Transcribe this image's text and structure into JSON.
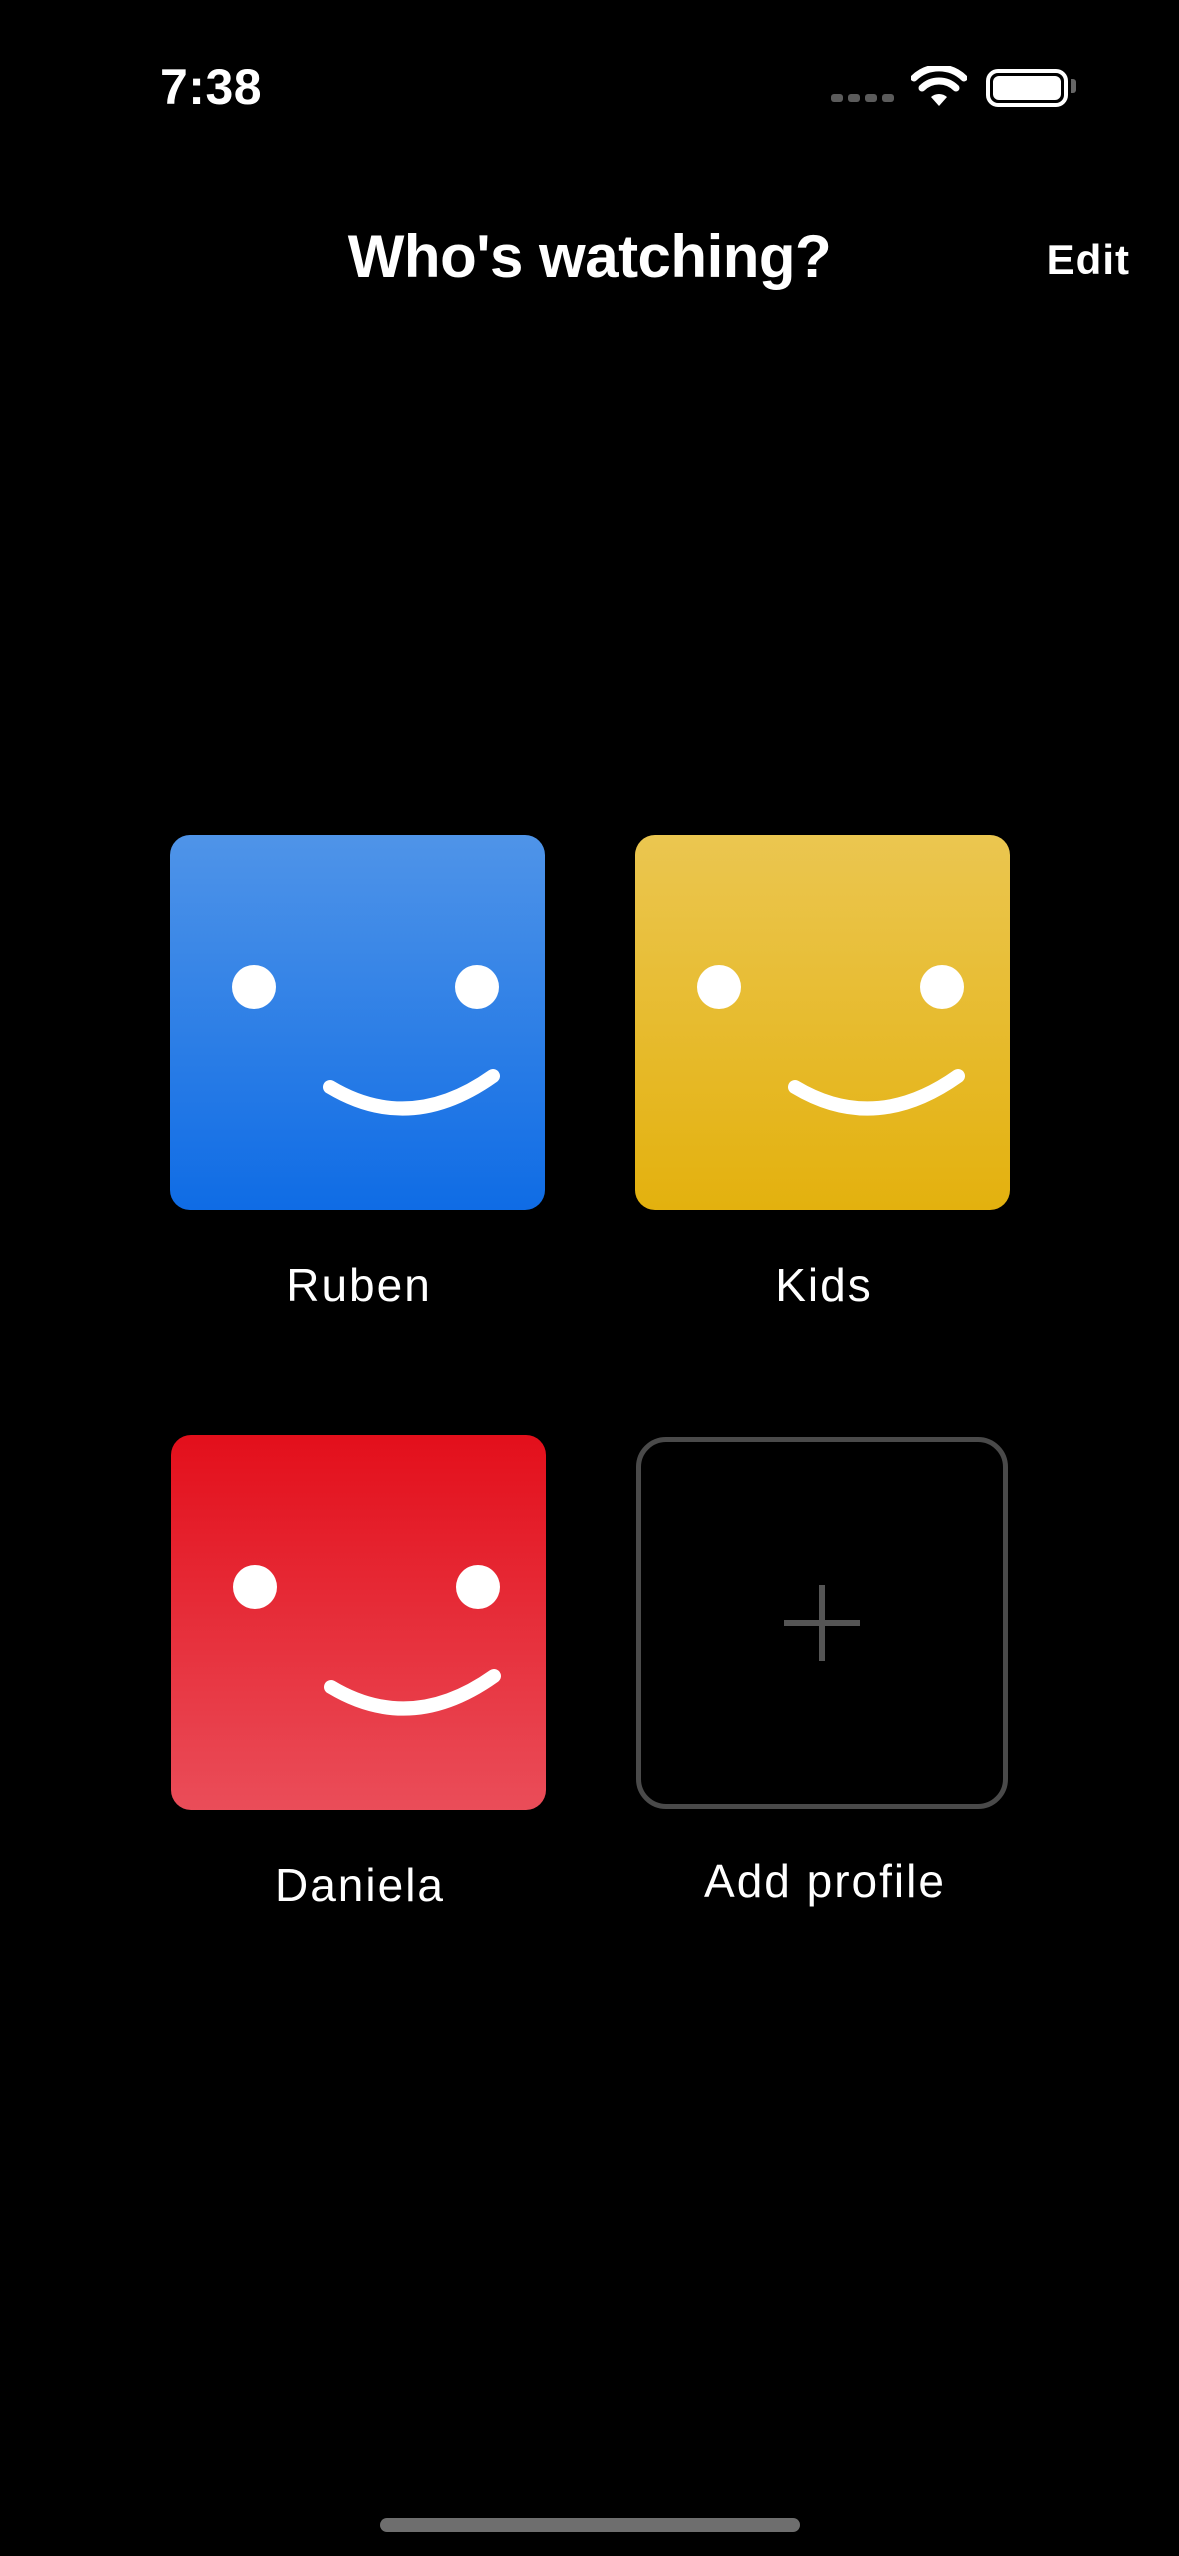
{
  "status_bar": {
    "time": "7:38"
  },
  "header": {
    "title": "Who's watching?",
    "edit_label": "Edit"
  },
  "profiles": [
    {
      "name": "Ruben",
      "color": "#1f77e6",
      "icon": "smiley-icon"
    },
    {
      "name": "Kids",
      "color": "#e6b720",
      "icon": "smiley-icon"
    },
    {
      "name": "Daniela",
      "color": "#e6202e",
      "icon": "smiley-icon"
    }
  ],
  "add_profile": {
    "label": "Add profile",
    "icon": "plus-icon"
  }
}
